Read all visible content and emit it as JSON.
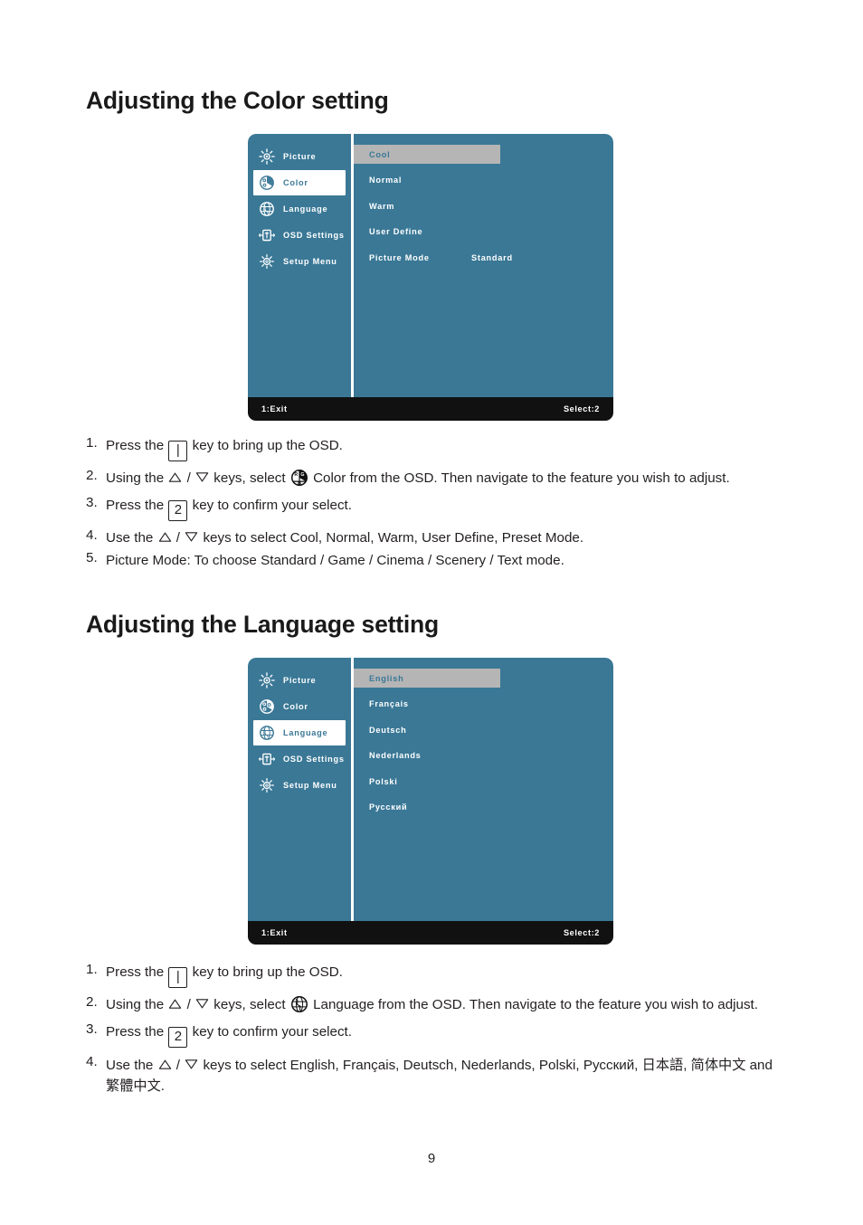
{
  "document": {
    "page_number": "9"
  },
  "colors": {
    "osd_background": "#3a7896",
    "osd_highlight": "#b5b5b5",
    "osd_footer": "#111111",
    "osd_text": "#ffffff",
    "body_text": "#231f20"
  },
  "sections": [
    {
      "id": "color",
      "title": "Adjusting the Color setting",
      "osd": {
        "sidebar": [
          {
            "label": "Picture",
            "icon": "brightness-sun-icon",
            "active": false
          },
          {
            "label": "Color",
            "icon": "color-wheel-icon",
            "active": true
          },
          {
            "label": "Language",
            "icon": "globe-icon",
            "active": false
          },
          {
            "label": "OSD Settings",
            "icon": "osd-settings-icon",
            "active": false
          },
          {
            "label": "Setup Menu",
            "icon": "gear-icon",
            "active": false
          }
        ],
        "options": [
          {
            "label": "Cool",
            "value": "",
            "highlight": true
          },
          {
            "label": "Normal",
            "value": "",
            "highlight": false
          },
          {
            "label": "Warm",
            "value": "",
            "highlight": false
          },
          {
            "label": "User Define",
            "value": "",
            "highlight": false
          },
          {
            "label": "Picture Mode",
            "value": "Standard",
            "highlight": false
          }
        ],
        "footer": {
          "exit": "1:Exit",
          "select": "Select:2"
        }
      },
      "steps": [
        {
          "num": "1.",
          "html": "Press the <span class=\"keybox bar\">|</span> key to bring up the OSD."
        },
        {
          "num": "2.",
          "html": "Using the [TRI_UP] / [TRI_DOWN] keys, select [ICO_COLOR] Color from the OSD. Then navigate to the feature you wish to adjust."
        },
        {
          "num": "3.",
          "html": "Press the <span class=\"keybox\">2</span> key to confirm your select."
        },
        {
          "num": "4.",
          "html": "Use the [TRI_UP] / [TRI_DOWN] keys to select Cool, Normal, Warm, User Define, Preset Mode."
        },
        {
          "num": "5.",
          "html": "Picture Mode: To choose Standard / Game / Cinema / Scenery / Text mode."
        }
      ]
    },
    {
      "id": "language",
      "title": "Adjusting the Language setting",
      "osd": {
        "sidebar": [
          {
            "label": "Picture",
            "icon": "brightness-sun-icon",
            "active": false
          },
          {
            "label": "Color",
            "icon": "color-wheel-icon",
            "active": false
          },
          {
            "label": "Language",
            "icon": "globe-icon",
            "active": true
          },
          {
            "label": "OSD Settings",
            "icon": "osd-settings-icon",
            "active": false
          },
          {
            "label": "Setup Menu",
            "icon": "gear-icon",
            "active": false
          }
        ],
        "options": [
          {
            "label": "English",
            "value": "",
            "highlight": true
          },
          {
            "label": "Français",
            "value": "",
            "highlight": false
          },
          {
            "label": "Deutsch",
            "value": "",
            "highlight": false
          },
          {
            "label": "Nederlands",
            "value": "",
            "highlight": false
          },
          {
            "label": "Polski",
            "value": "",
            "highlight": false
          },
          {
            "label": "Русский",
            "value": "",
            "highlight": false
          }
        ],
        "footer": {
          "exit": "1:Exit",
          "select": "Select:2"
        }
      },
      "steps": [
        {
          "num": "1.",
          "html": "Press the <span class=\"keybox bar\">|</span> key to bring up the OSD."
        },
        {
          "num": "2.",
          "html": "Using the [TRI_UP] / [TRI_DOWN] keys, select [ICO_GLOBE] Language from the OSD. Then navigate to the feature you wish to adjust."
        },
        {
          "num": "3.",
          "html": "Press the <span class=\"keybox\">2</span> key to confirm your select."
        },
        {
          "num": "4.",
          "html": "Use the [TRI_UP] / [TRI_DOWN] keys to select English, Français, Deutsch, Nederlands, Polski, Русский, <span class=\"cjk\">日本語</span>, <span class=\"cjk\">简体中文</span> and <span class=\"cjk\">繁體中文</span>."
        }
      ]
    }
  ]
}
